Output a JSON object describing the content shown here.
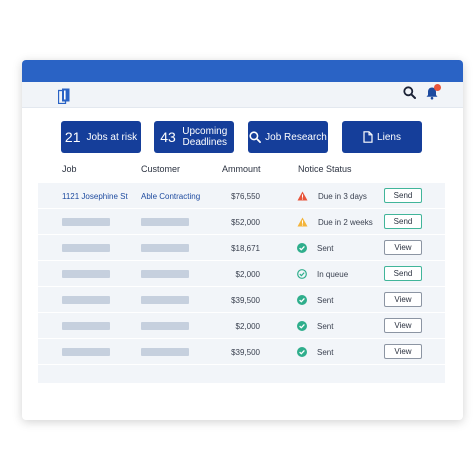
{
  "colors": {
    "titlebar": "#2a63c5",
    "card_bg": "#153e9a",
    "send_border": "#41b59a",
    "success": "#2fae8c",
    "danger": "#e8553b",
    "warning": "#f3b43b"
  },
  "header": {
    "logo_icon": "document-stack-logo",
    "search_icon": "search-icon",
    "bell_icon": "bell-icon"
  },
  "cards": [
    {
      "num": "21",
      "label": "Jobs at risk"
    },
    {
      "num": "43",
      "label": "Upcoming Deadlines"
    },
    {
      "label": "Job Research",
      "icon": "search-icon"
    },
    {
      "label": "Liens",
      "icon": "document-icon"
    }
  ],
  "table": {
    "headers": {
      "job": "Job",
      "customer": "Customer",
      "amount": "Ammount",
      "status": "Notice Status"
    },
    "rows": [
      {
        "job": "1121 Josephine St",
        "customer": "Able Contracting",
        "amount": "$76,550",
        "status": "Due in 3 days",
        "status_icon": "danger-triangle-icon",
        "action": "Send"
      },
      {
        "job": "",
        "customer": "",
        "amount": "$52,000",
        "status": "Due in 2 weeks",
        "status_icon": "warning-triangle-icon",
        "action": "Send"
      },
      {
        "job": "",
        "customer": "",
        "amount": "$18,671",
        "status": "Sent",
        "status_icon": "check-circle-icon",
        "action": "View"
      },
      {
        "job": "",
        "customer": "",
        "amount": "$2,000",
        "status": "In queue",
        "status_icon": "check-outline-icon",
        "action": "Send"
      },
      {
        "job": "",
        "customer": "",
        "amount": "$39,500",
        "status": "Sent",
        "status_icon": "check-circle-icon",
        "action": "View"
      },
      {
        "job": "",
        "customer": "",
        "amount": "$2,000",
        "status": "Sent",
        "status_icon": "check-circle-icon",
        "action": "View"
      },
      {
        "job": "",
        "customer": "",
        "amount": "$39,500",
        "status": "Sent",
        "status_icon": "check-circle-icon",
        "action": "View"
      }
    ]
  }
}
